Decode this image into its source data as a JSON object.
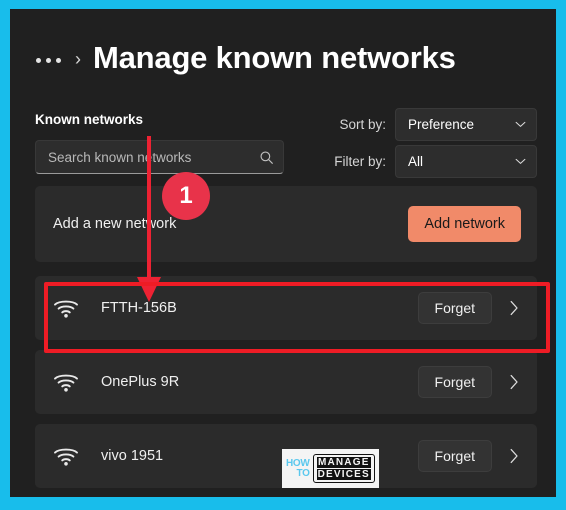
{
  "theme": {
    "frame_color": "#18bdeb",
    "window_bg": "#202020",
    "card_bg": "#2b2b2b",
    "accent_button": "#f18a69",
    "annotation_red": "#ee1c25",
    "badge_red": "#e8334a"
  },
  "header": {
    "breadcrumb_overflow": "•••",
    "breadcrumb_separator": "›",
    "title": "Manage known networks"
  },
  "toolbar": {
    "known_networks_label": "Known networks",
    "search": {
      "value": "",
      "placeholder": "Search known networks",
      "icon": "search-icon"
    },
    "sort": {
      "label": "Sort by:",
      "value": "Preference",
      "icon": "chevron-down-icon"
    },
    "filter": {
      "label": "Filter by:",
      "value": "All",
      "icon": "chevron-down-icon"
    }
  },
  "add_network_row": {
    "text": "Add a new network",
    "button_label": "Add network"
  },
  "networks": [
    {
      "name": "FTTH-156B",
      "icon": "wifi-icon",
      "forget_label": "Forget",
      "chevron": "chevron-right-icon",
      "highlighted": true
    },
    {
      "name": "OnePlus 9R",
      "icon": "wifi-icon",
      "forget_label": "Forget",
      "chevron": "chevron-right-icon",
      "highlighted": false
    },
    {
      "name": "vivo 1951",
      "icon": "wifi-icon",
      "forget_label": "Forget",
      "chevron": "chevron-right-icon",
      "highlighted": false
    }
  ],
  "annotations": {
    "step_number": "1",
    "arrow": "down-arrow",
    "highlight_target": "FTTH-156B"
  },
  "watermark": {
    "line1": "HOW",
    "line2": "TO",
    "line3": "MANAGE",
    "line4": "DEVICES"
  }
}
